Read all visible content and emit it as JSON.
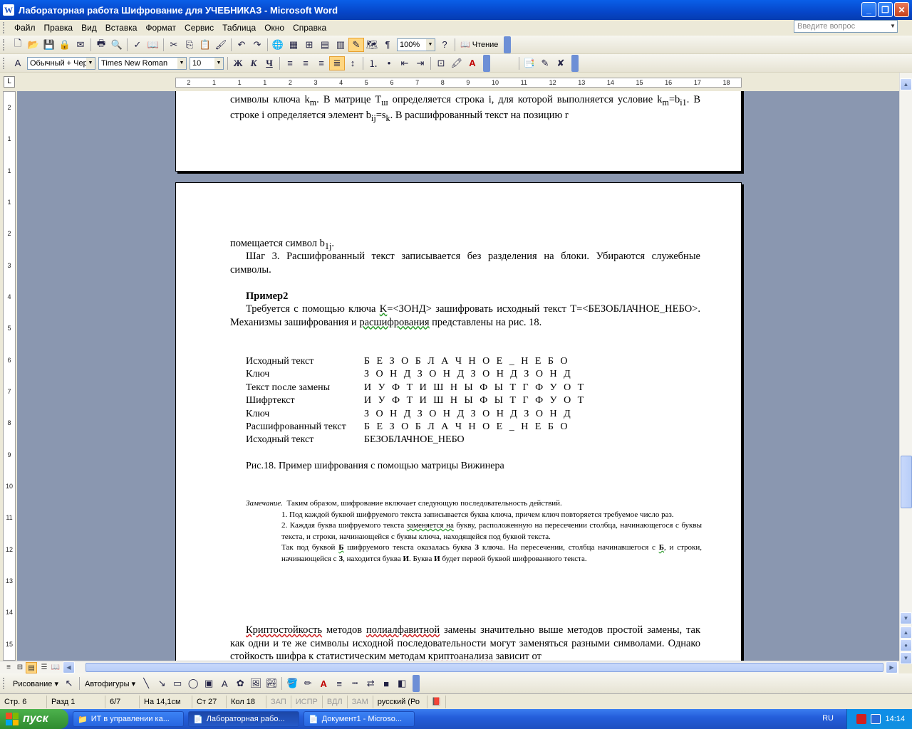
{
  "window": {
    "title": "Лабораторная работа Шифрование для УЧЕБНИКАЗ - Microsoft Word"
  },
  "menu": {
    "items": [
      "Файл",
      "Правка",
      "Вид",
      "Вставка",
      "Формат",
      "Сервис",
      "Таблица",
      "Окно",
      "Справка"
    ],
    "ask_placeholder": "Введите вопрос"
  },
  "toolbar": {
    "zoom": "100%",
    "reading_label": "Чтение"
  },
  "format_bar": {
    "style": "Обычный + Чер",
    "font": "Times New Roman",
    "size": "10"
  },
  "ruler": {
    "h_ticks": [
      "2",
      "1",
      "1",
      "1",
      "2",
      "3",
      "4",
      "5",
      "6",
      "7",
      "8",
      "9",
      "10",
      "11",
      "12",
      "13",
      "14",
      "15",
      "16",
      "17",
      "18"
    ],
    "v_ticks": [
      "2",
      "1",
      "1",
      "1",
      "2",
      "3",
      "4",
      "5",
      "6",
      "7",
      "8",
      "9",
      "10",
      "11",
      "12",
      "13",
      "14",
      "15"
    ]
  },
  "doc": {
    "p1_line1_a": "символы ключа k",
    "p1_line1_sub1": "m",
    "p1_line1_b": ". В матрице T",
    "p1_line1_sub2": "ш",
    "p1_line1_c": " определяется строка i, для которой выполняется условие",
    "p1_line2_a": "k",
    "p1_line2_sub1": "m",
    "p1_line2_b": "=b",
    "p1_line2_sub2": "i1",
    "p1_line2_c": ". В строке i определяется элемент b",
    "p1_line2_sub3": "ij",
    "p1_line2_d": "=s",
    "p1_line2_sub4": "k",
    "p1_line2_e": ". В расшифрованный текст на позицию r",
    "p2_line1_a": "помещается символ b",
    "p2_line1_sub": "1j",
    "p2_line1_b": ".",
    "step3": "Шаг 3. Расшифрованный текст записывается без разделения на блоки. Убираются служебные символы.",
    "example_title": "Пример2",
    "req_a": "Требуется с помощью ключа ",
    "req_key": "K",
    "req_b": "=<ЗОНД> зашифровать исходный текст T=<БЕЗОБЛАЧНОЕ_НЕБО>. Механизмы зашифрования и ",
    "req_dec": "расшифрования",
    "req_c": " представлены на рис. 18.",
    "table": [
      {
        "label": "Исходный текст",
        "value": "Б Е З О Б Л  А Ч Н О Е _ Н Е Б О"
      },
      {
        "label": "Ключ",
        "value": "З О Н Д З О Н Д З О Н Д З О Н Д"
      },
      {
        "label": "Текст после замены",
        "value": "И У Ф Т И Ш Н Ы Ф Ы Т Г Ф У О Т"
      },
      {
        "label": "Шифртекст",
        "value": "И У Ф Т   И Ш Н Ы   Ф Ы Т Г   Ф У О Т"
      },
      {
        "label": "Ключ",
        "value": "З О Н Д   З О Н Д   З О Н Д   З О Н Д"
      },
      {
        "label": "Расшифрованный текст",
        "value": "Б Е З О   Б Л А Ч   Н О Е _   Н Е Б О"
      },
      {
        "label": "Исходный текст",
        "value": "БЕЗОБЛАЧНОЕ_НЕБО"
      }
    ],
    "caption": "Рис.18. Пример шифрования с помощью матрицы Вижинера",
    "note_label": "Замечание.",
    "note_intro": "Таким образом, шифрование включает следующую последовательность действий.",
    "note_item1": "1.   Под каждой буквой шифруемого текста записывается буква ключа, причем ключ повторяется требуемое число раз.",
    "note_item2_a": "2.   Каждая буква шифруемого текста ",
    "note_item2_sq": "заменяется на",
    "note_item2_b": " букву, расположенную на пересечении столбца, начинающегося с буквы текста, и строки, начинающейся с буквы ключа, находящейся под буквой текста.",
    "note_item3_a": "Так под буквой ",
    "note_item3_b1": "Б",
    "note_item3_c": " шифруемого текста оказалась буква ",
    "note_item3_z": "З",
    "note_item3_d": " ключа. На пересечении, столбца начинавшегося с ",
    "note_item3_b2": "Б",
    "note_item3_e": ", и строки, начинающейся с ",
    "note_item3_z2": "З",
    "note_item3_f": ", находится буква ",
    "note_item3_i": "И",
    "note_item3_g": ". Буква ",
    "note_item3_i2": "И",
    "note_item3_h": " будет первой буквой шифрованного текста.",
    "last_a": "Криптостойкость",
    "last_b": " методов ",
    "last_c": "полиалфавитной",
    "last_d": " замены значительно выше методов простой замены, так как одни и те же символы исходной последовательности могут заменяться разными символами. Однако стойкость шифра к статистическим методам ",
    "last_e": "криптоанализа",
    "last_f": " зависит от"
  },
  "drawbar": {
    "draw": "Рисование",
    "autoshapes": "Автофигуры"
  },
  "status": {
    "page": "Стр. 6",
    "section": "Разд 1",
    "pages": "6/7",
    "at": "На 14,1см",
    "line": "Ст 27",
    "col": "Кол 18",
    "rec": "ЗАП",
    "trk": "ИСПР",
    "ext": "ВДЛ",
    "ovr": "ЗАМ",
    "lang": "русский (Ро"
  },
  "taskbar": {
    "start": "пуск",
    "tasks": [
      "ИТ в управлении ка...",
      "Лабораторная рабо...",
      "Документ1 - Microso..."
    ],
    "lang": "RU",
    "clock": "14:14"
  }
}
